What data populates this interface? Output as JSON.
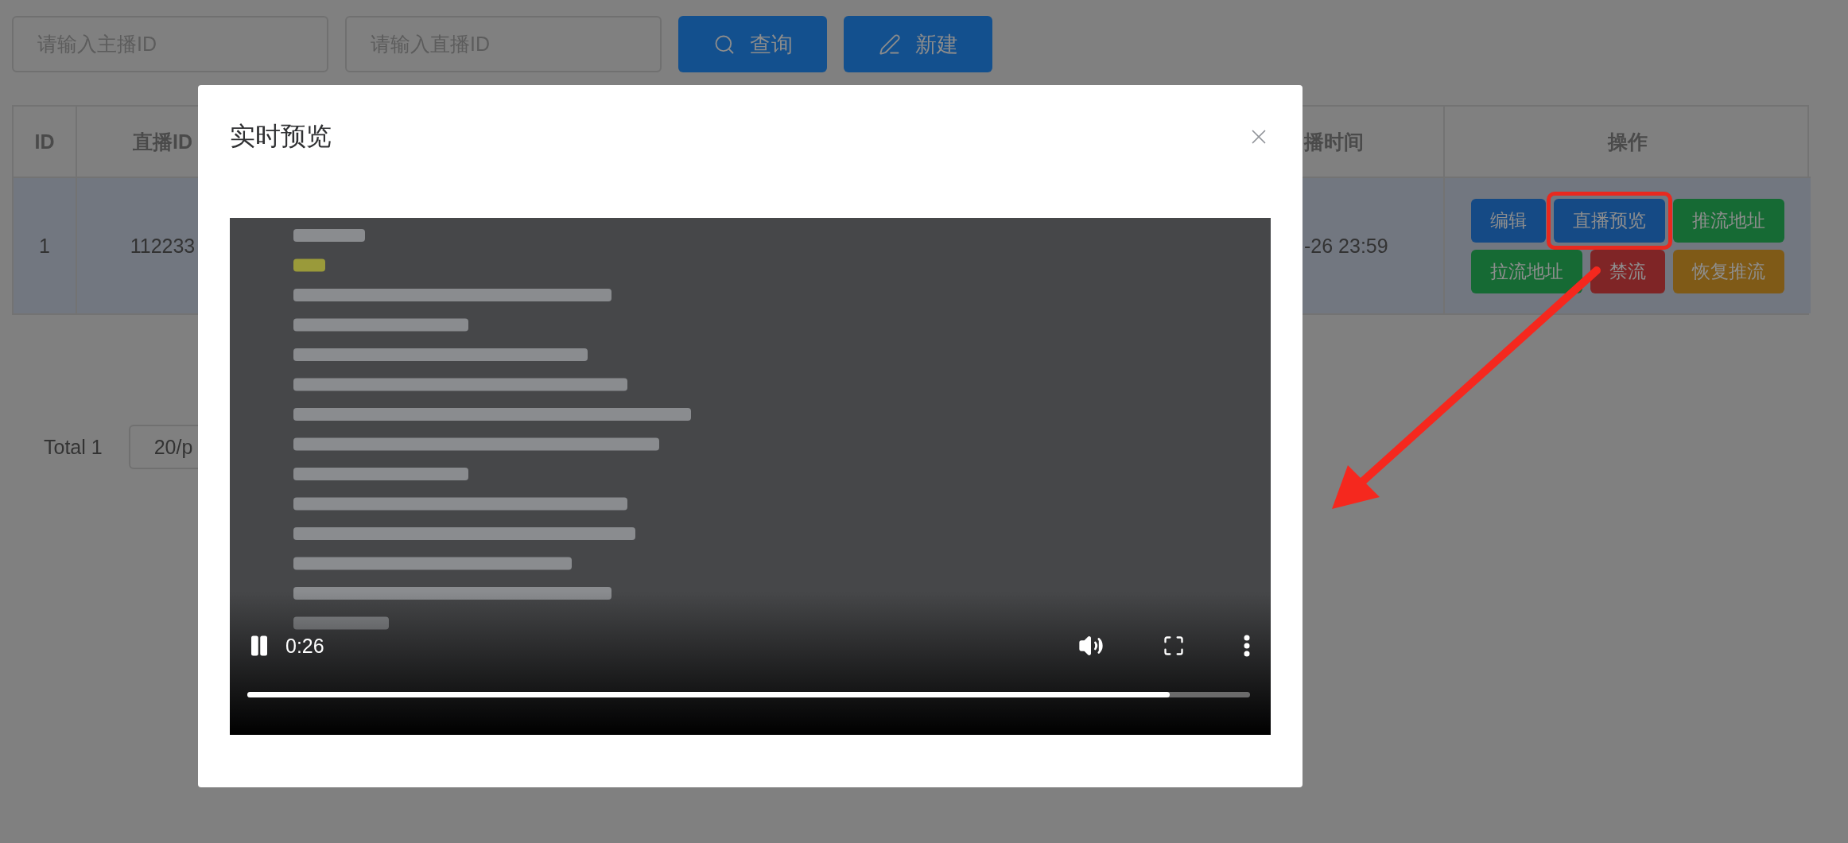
{
  "search_fields": [
    {
      "placeholder": "请输入主播ID"
    },
    {
      "placeholder": "请输入直播ID"
    }
  ],
  "toolbar_buttons": [
    {
      "label": "查询"
    },
    {
      "label": "新建"
    }
  ],
  "table": {
    "columns": [
      "ID",
      "直播ID",
      "播时间",
      "操作"
    ],
    "rows": [
      {
        "cells": [
          "1",
          "112233",
          "-26 23:59"
        ],
        "actions": [
          {
            "label": "编辑",
            "color": "#154a85",
            "highlighted": false
          },
          {
            "label": "直播预览",
            "color": "#154a85",
            "highlighted": true
          },
          {
            "label": "推流地址",
            "color": "#166a34",
            "highlighted": false
          },
          {
            "label": "拉流地址",
            "color": "#166a34",
            "highlighted": false
          },
          {
            "label": "禁流",
            "color": "#7f2526",
            "highlighted": false
          },
          {
            "label": "恢复推流",
            "color": "#7f5a17",
            "highlighted": false
          }
        ]
      }
    ]
  },
  "pagination": {
    "total": "Total 1",
    "page_size": "20/p"
  },
  "modal": {
    "title": "实时预览",
    "video": {
      "kind": "picture",
      "time": "0:26",
      "level": 0.92,
      "playing": true
    }
  }
}
